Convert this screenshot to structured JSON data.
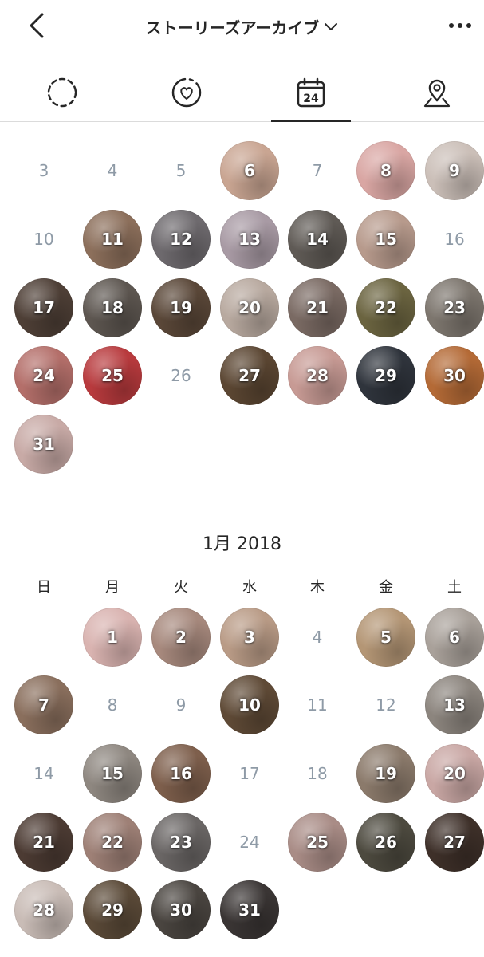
{
  "header": {
    "title": "ストーリーズアーカイブ",
    "back_icon": "chevron-left-icon",
    "title_dropdown_icon": "chevron-down-icon",
    "more_icon": "more-horizontal-icon"
  },
  "tabs": [
    {
      "name": "tab-stories-archive",
      "icon": "dashed-circle-icon",
      "active": false
    },
    {
      "name": "tab-highlights",
      "icon": "heart-circle-icon",
      "active": false
    },
    {
      "name": "tab-calendar",
      "icon": "calendar-icon",
      "label": "24",
      "active": true
    },
    {
      "name": "tab-map",
      "icon": "location-pin-icon",
      "active": false
    }
  ],
  "december": {
    "days": [
      {
        "d": "3",
        "story": false
      },
      {
        "d": "4",
        "story": false
      },
      {
        "d": "5",
        "story": false
      },
      {
        "d": "6",
        "story": true,
        "bg": "#c9a592"
      },
      {
        "d": "7",
        "story": false
      },
      {
        "d": "8",
        "story": true,
        "bg": "#d9a6a3"
      },
      {
        "d": "9",
        "story": true,
        "bg": "#cbbfb8"
      },
      {
        "d": "10",
        "story": false
      },
      {
        "d": "11",
        "story": true,
        "bg": "#8c6f5b"
      },
      {
        "d": "12",
        "story": true,
        "bg": "#6e6a6e"
      },
      {
        "d": "13",
        "story": true,
        "bg": "#a89aa4"
      },
      {
        "d": "14",
        "story": true,
        "bg": "#5f5a55"
      },
      {
        "d": "15",
        "story": true,
        "bg": "#b79a8c"
      },
      {
        "d": "16",
        "story": false
      },
      {
        "d": "17",
        "story": true,
        "bg": "#4e3f36"
      },
      {
        "d": "18",
        "story": true,
        "bg": "#5d5650"
      },
      {
        "d": "19",
        "story": true,
        "bg": "#5a4738"
      },
      {
        "d": "20",
        "story": true,
        "bg": "#b8a99f"
      },
      {
        "d": "21",
        "story": true,
        "bg": "#7a6a63"
      },
      {
        "d": "22",
        "story": true,
        "bg": "#6b6440"
      },
      {
        "d": "23",
        "story": true,
        "bg": "#7d766e"
      },
      {
        "d": "24",
        "story": true,
        "bg": "#b46f6a"
      },
      {
        "d": "25",
        "story": true,
        "bg": "#b83a3d"
      },
      {
        "d": "26",
        "story": false
      },
      {
        "d": "27",
        "story": true,
        "bg": "#5b4632"
      },
      {
        "d": "28",
        "story": true,
        "bg": "#c79a94"
      },
      {
        "d": "29",
        "story": true,
        "bg": "#2f343c"
      },
      {
        "d": "30",
        "story": true,
        "bg": "#b46a36"
      },
      {
        "d": "31",
        "story": true,
        "bg": "#c8aaa6"
      }
    ]
  },
  "january": {
    "title": "1月 2018",
    "weekdays": [
      "日",
      "月",
      "火",
      "水",
      "木",
      "金",
      "土"
    ],
    "days": [
      {
        "d": "1",
        "story": true,
        "bg": "#d9b3b0"
      },
      {
        "d": "2",
        "story": true,
        "bg": "#a7897d"
      },
      {
        "d": "3",
        "story": true,
        "bg": "#b99b86"
      },
      {
        "d": "4",
        "story": false
      },
      {
        "d": "5",
        "story": true,
        "bg": "#b49675"
      },
      {
        "d": "6",
        "story": true,
        "bg": "#a9a19a"
      },
      {
        "d": "7",
        "story": true,
        "bg": "#8a6f5d"
      },
      {
        "d": "8",
        "story": false
      },
      {
        "d": "9",
        "story": false
      },
      {
        "d": "10",
        "story": true,
        "bg": "#5f4a36"
      },
      {
        "d": "11",
        "story": false
      },
      {
        "d": "12",
        "story": false
      },
      {
        "d": "13",
        "story": true,
        "bg": "#8c857e"
      },
      {
        "d": "14",
        "story": false
      },
      {
        "d": "15",
        "story": true,
        "bg": "#8e8780"
      },
      {
        "d": "16",
        "story": true,
        "bg": "#7e5f4c"
      },
      {
        "d": "17",
        "story": false
      },
      {
        "d": "18",
        "story": false
      },
      {
        "d": "19",
        "story": true,
        "bg": "#8b7a6b"
      },
      {
        "d": "20",
        "story": true,
        "bg": "#c9a7a4"
      },
      {
        "d": "21",
        "story": true,
        "bg": "#4c3b33"
      },
      {
        "d": "22",
        "story": true,
        "bg": "#9e8076"
      },
      {
        "d": "23",
        "story": true,
        "bg": "#6a6665"
      },
      {
        "d": "24",
        "story": false
      },
      {
        "d": "25",
        "story": true,
        "bg": "#a98c86"
      },
      {
        "d": "26",
        "story": true,
        "bg": "#4d4a3f"
      },
      {
        "d": "27",
        "story": true,
        "bg": "#3e3029"
      },
      {
        "d": "28",
        "story": true,
        "bg": "#c9bcb6"
      },
      {
        "d": "29",
        "story": true,
        "bg": "#5b4a38"
      },
      {
        "d": "30",
        "story": true,
        "bg": "#4a4540"
      },
      {
        "d": "31",
        "story": true,
        "bg": "#3a3534"
      }
    ]
  }
}
